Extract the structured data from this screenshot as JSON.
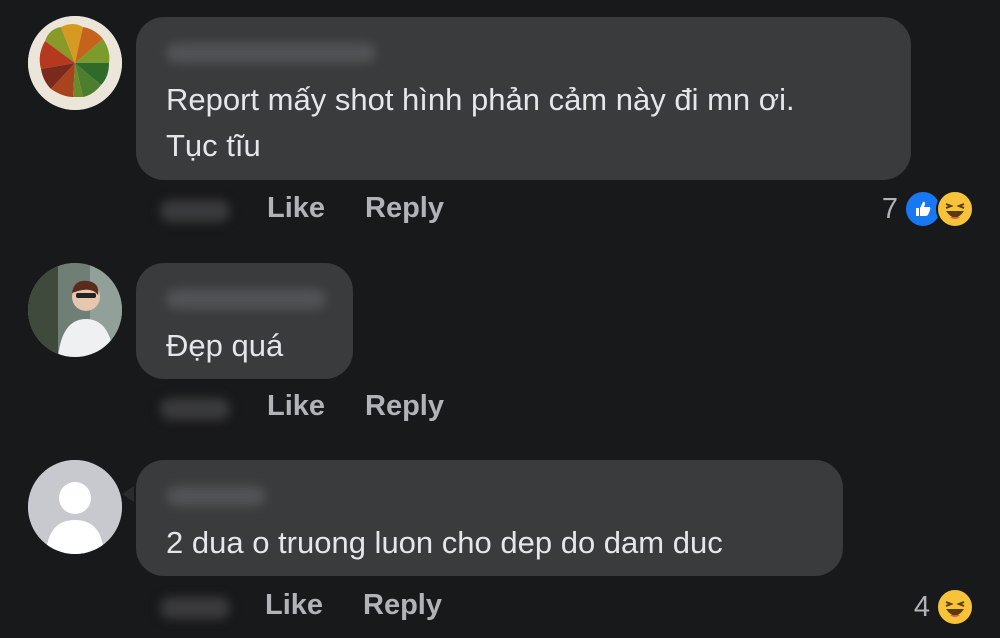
{
  "comments": [
    {
      "text_lines": [
        "Report mấy shot hình phản cảm này đi mn ơi.",
        "Tục tĩu"
      ],
      "like_label": "Like",
      "reply_label": "Reply",
      "reaction_count": "7",
      "reactions": [
        "like-icon",
        "haha-icon"
      ]
    },
    {
      "text_lines": [
        "Đẹp quá"
      ],
      "like_label": "Like",
      "reply_label": "Reply"
    },
    {
      "text_lines": [
        "2 dua o truong luon cho dep do dam duc"
      ],
      "like_label": "Like",
      "reply_label": "Reply",
      "reaction_count": "4",
      "reactions": [
        "haha-icon"
      ]
    }
  ],
  "colors": {
    "background": "#18191a",
    "bubble": "#3a3b3c",
    "text": "#e4e6eb",
    "secondary_text": "#b0b3b8",
    "like_blue": "#1877f2",
    "haha_yellow": "#f7c33b"
  }
}
